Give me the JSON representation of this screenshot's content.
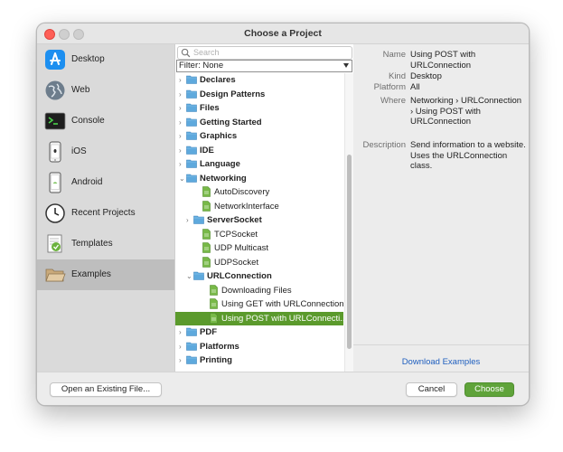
{
  "window": {
    "title": "Choose a Project"
  },
  "sidebar": {
    "items": [
      {
        "label": "Desktop",
        "icon": "app-store-icon"
      },
      {
        "label": "Web",
        "icon": "globe-icon"
      },
      {
        "label": "Console",
        "icon": "terminal-icon"
      },
      {
        "label": "iOS",
        "icon": "iphone-icon"
      },
      {
        "label": "Android",
        "icon": "android-phone-icon"
      },
      {
        "label": "Recent Projects",
        "icon": "clock-icon"
      },
      {
        "label": "Templates",
        "icon": "templates-icon"
      },
      {
        "label": "Examples",
        "icon": "folder-open-icon"
      }
    ],
    "selected": "Examples"
  },
  "search": {
    "placeholder": "Search",
    "value": ""
  },
  "filter": {
    "label": "Filter: None"
  },
  "tree": [
    {
      "label": "Declares",
      "type": "folder",
      "level": 0,
      "expanded": false
    },
    {
      "label": "Design Patterns",
      "type": "folder",
      "level": 0,
      "expanded": false
    },
    {
      "label": "Files",
      "type": "folder",
      "level": 0,
      "expanded": false
    },
    {
      "label": "Getting Started",
      "type": "folder",
      "level": 0,
      "expanded": false
    },
    {
      "label": "Graphics",
      "type": "folder",
      "level": 0,
      "expanded": false
    },
    {
      "label": "IDE",
      "type": "folder",
      "level": 0,
      "expanded": false
    },
    {
      "label": "Language",
      "type": "folder",
      "level": 0,
      "expanded": false
    },
    {
      "label": "Networking",
      "type": "folder",
      "level": 0,
      "expanded": true
    },
    {
      "label": "AutoDiscovery",
      "type": "file",
      "level": 1
    },
    {
      "label": "NetworkInterface",
      "type": "file",
      "level": 1
    },
    {
      "label": "ServerSocket",
      "type": "folder",
      "level": 1,
      "expanded": false
    },
    {
      "label": "TCPSocket",
      "type": "file",
      "level": 1
    },
    {
      "label": "UDP Multicast",
      "type": "file",
      "level": 1
    },
    {
      "label": "UDPSocket",
      "type": "file",
      "level": 1
    },
    {
      "label": "URLConnection",
      "type": "folder",
      "level": 1,
      "expanded": true
    },
    {
      "label": "Downloading Files",
      "type": "file",
      "level": 2
    },
    {
      "label": "Using GET with URLConnection",
      "type": "file",
      "level": 2
    },
    {
      "label": "Using POST with URLConnecti...",
      "type": "file",
      "level": 2,
      "selected": true
    },
    {
      "label": "PDF",
      "type": "folder",
      "level": 0,
      "expanded": false
    },
    {
      "label": "Platforms",
      "type": "folder",
      "level": 0,
      "expanded": false
    },
    {
      "label": "Printing",
      "type": "folder",
      "level": 0,
      "expanded": false
    }
  ],
  "details": {
    "name_key": "Name",
    "name": "Using POST with URLConnection",
    "kind_key": "Kind",
    "kind": "Desktop",
    "platform_key": "Platform",
    "platform": "All",
    "where_key": "Where",
    "where": "Networking › URLConnection › Using POST with URLConnection",
    "description_key": "Description",
    "description": "Send information to a website. Uses the URLConnection class.",
    "download_link": "Download Examples"
  },
  "buttons": {
    "open_existing": "Open an Existing File...",
    "cancel": "Cancel",
    "choose": "Choose"
  },
  "colors": {
    "accent_green": "#5b9a2c",
    "folder_blue": "#5ea9dd",
    "link_blue": "#1f5fbf"
  }
}
